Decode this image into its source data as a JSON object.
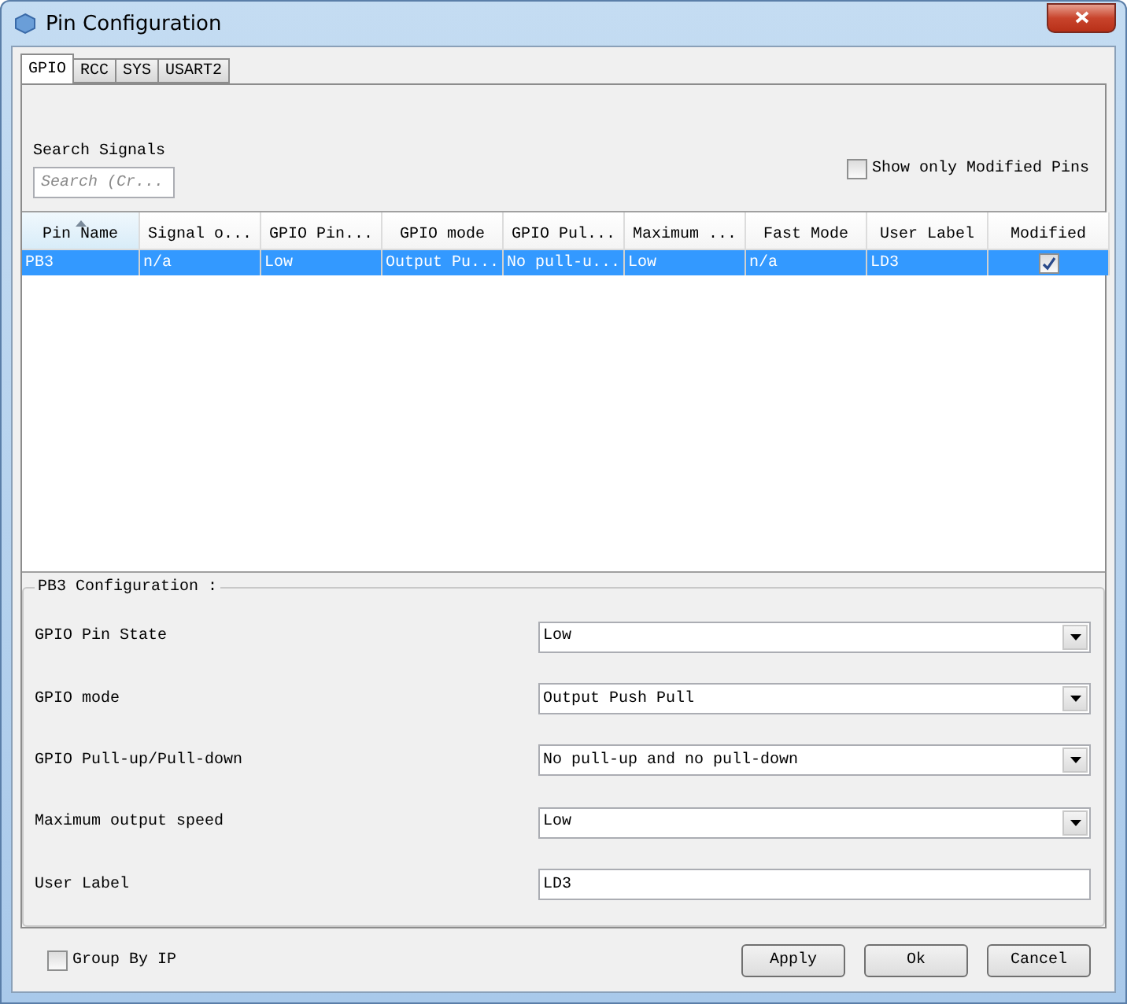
{
  "window": {
    "title": "Pin Configuration"
  },
  "tabs": [
    {
      "label": "GPIO",
      "selected": true
    },
    {
      "label": "RCC",
      "selected": false
    },
    {
      "label": "SYS",
      "selected": false
    },
    {
      "label": "USART2",
      "selected": false
    }
  ],
  "search": {
    "label": "Search Signals",
    "placeholder": "Search (Cr..."
  },
  "show_only_modified": {
    "label": "Show only Modified Pins",
    "checked": false
  },
  "table": {
    "columns": [
      {
        "label": "Pin Name",
        "sorted": true
      },
      {
        "label": "Signal o...",
        "sorted": false
      },
      {
        "label": "GPIO Pin...",
        "sorted": false
      },
      {
        "label": "GPIO mode",
        "sorted": false
      },
      {
        "label": "GPIO Pul...",
        "sorted": false
      },
      {
        "label": "Maximum ...",
        "sorted": false
      },
      {
        "label": "Fast Mode",
        "sorted": false
      },
      {
        "label": "User Label",
        "sorted": false
      },
      {
        "label": "Modified",
        "sorted": false
      }
    ],
    "rows": [
      {
        "cells": [
          "PB3",
          "n/a",
          "Low",
          "Output Pu...",
          "No pull-u...",
          "Low",
          "n/a",
          "LD3"
        ],
        "modified": true,
        "selected": true
      }
    ]
  },
  "config": {
    "title": "PB3 Configuration :",
    "fields": [
      {
        "label": "GPIO Pin State",
        "kind": "select",
        "value": "Low"
      },
      {
        "label": "GPIO mode",
        "kind": "select",
        "value": "Output Push Pull"
      },
      {
        "label": "GPIO Pull-up/Pull-down",
        "kind": "select",
        "value": "No pull-up and no pull-down"
      },
      {
        "label": "Maximum output speed",
        "kind": "select",
        "value": "Low"
      },
      {
        "label": "User Label",
        "kind": "text",
        "value": "LD3"
      }
    ]
  },
  "group_by_ip": {
    "label": "Group By IP",
    "checked": false
  },
  "buttons": [
    "Apply",
    "Ok",
    "Cancel"
  ]
}
